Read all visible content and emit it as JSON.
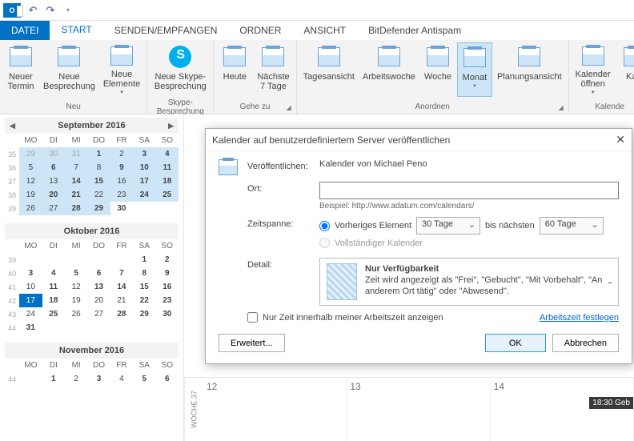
{
  "qat": {
    "undo": "↶",
    "redo": "↷"
  },
  "tabs": {
    "file": "DATEI",
    "start": "START",
    "senden": "SENDEN/EMPFANGEN",
    "ordner": "ORDNER",
    "ansicht": "ANSICHT",
    "bitdefender": "BitDefender Antispam"
  },
  "ribbon": {
    "neuer_termin": "Neuer\nTermin",
    "neue_besprechung": "Neue\nBesprechung",
    "neue_elemente": "Neue\nElemente",
    "group_neu": "Neu",
    "skype": "Neue Skype-\nBesprechung",
    "group_skype": "Skype-Besprechung",
    "heute": "Heute",
    "n7": "Nächste\n7 Tage",
    "group_gehe": "Gehe zu",
    "tag": "Tagesansicht",
    "aw": "Arbeitswoche",
    "woche": "Woche",
    "monat": "Monat",
    "plan": "Planungsansicht",
    "group_anordnen": "Anordnen",
    "kal_open": "Kalender\nöffnen",
    "kal_more": "Ka",
    "group_kal": "Kalende"
  },
  "minical": {
    "sep_title": "September 2016",
    "okt_title": "Oktober 2016",
    "nov_title": "November 2016",
    "dow": [
      "MO",
      "DI",
      "MI",
      "DO",
      "FR",
      "SA",
      "SO"
    ]
  },
  "grid": {
    "week_label": "WOCHE 37",
    "d1": "12",
    "d2": "13",
    "d3": "14",
    "event": "18:30 Geb"
  },
  "dialog": {
    "title": "Kalender auf benutzerdefiniertem Server veröffentlichen",
    "lbl_publish": "Veröffentlichen:",
    "val_publish": "Kalender von Michael Peno",
    "lbl_ort": "Ort:",
    "ort_value": "",
    "hint": "Beispiel: http://www.adatum.com/calendars/",
    "lbl_span": "Zeitspanne:",
    "radio_prev": "Vorheriges Element",
    "combo_prev": "30 Tage",
    "span_mid": "bis nächsten",
    "combo_next": "60 Tage",
    "radio_full": "Vollständiger Kalender",
    "lbl_detail": "Detail:",
    "detail_title": "Nur Verfügbarkeit",
    "detail_desc": "Zeit wird angezeigt als \"Frei\", \"Gebucht\", \"Mit Vorbehalt\", \"An anderem Ort tätig\" oder \"Abwesend\".",
    "chk_label": "Nur Zeit innerhalb meiner Arbeitszeit anzeigen",
    "link_arbeit": "Arbeitszeit festlegen",
    "btn_erw": "Erweitert...",
    "btn_ok": "OK",
    "btn_cancel": "Abbrechen"
  }
}
